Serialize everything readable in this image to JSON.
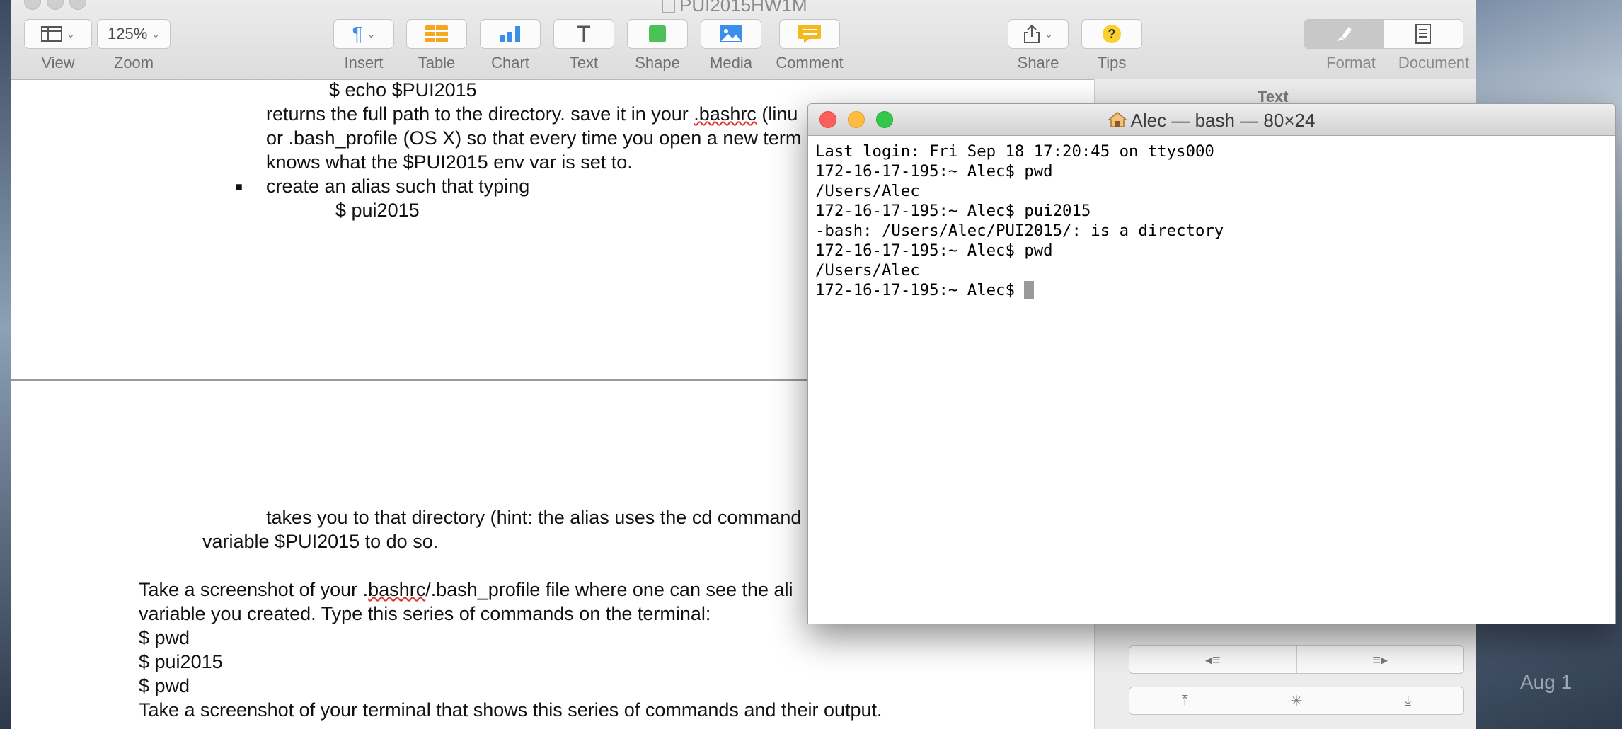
{
  "pages_window": {
    "title": "PUI2015HW1M",
    "toolbar": {
      "view_label": "View",
      "zoom_value": "125%",
      "zoom_label": "Zoom",
      "insert_label": "Insert",
      "table_label": "Table",
      "chart_label": "Chart",
      "text_label": "Text",
      "shape_label": "Shape",
      "media_label": "Media",
      "comment_label": "Comment",
      "share_label": "Share",
      "tips_label": "Tips",
      "format_label": "Format",
      "document_label": "Document"
    },
    "inspector": {
      "heading": "Text"
    },
    "document": {
      "lines": {
        "l1": "$ echo $PUI2015",
        "l2a": "returns the full path to the directory. save  it in your ",
        "l2b": ".bashrc",
        "l2c": " (linu",
        "l3": "or .bash_profile (OS X) so that every time you open a new term",
        "l4": "knows what the $PUI2015 env var is set to.",
        "l5": "create an alias such that typing",
        "l6": "$ pui2015",
        "l7": "takes you to that directory (hint: the alias uses the cd command",
        "l8": "variable $PUI2015 to do so.",
        "l9a": "Take a screenshot of your .",
        "l9b": "bashrc",
        "l9c": "/.bash_profile file where one can see the ali",
        "l10": "variable you created. Type this series of commands on the terminal:",
        "l11": "$ pwd",
        "l12": "$ pui2015",
        "l13": "$ pwd",
        "l14": "Take a screenshot of your terminal that shows this series of commands and their output."
      },
      "bullet_glyph": "■"
    }
  },
  "terminal": {
    "title": "Alec — bash — 80×24",
    "lines": [
      "Last login: Fri Sep 18 17:20:45 on ttys000",
      "172-16-17-195:~ Alec$ pwd",
      "/Users/Alec",
      "172-16-17-195:~ Alec$ pui2015",
      "-bash: /Users/Alec/PUI2015/: is a directory",
      "172-16-17-195:~ Alec$ pwd",
      "/Users/Alec"
    ],
    "prompt": "172-16-17-195:~ Alec$ "
  },
  "desktop": {
    "date_text": "Aug 1"
  },
  "colors": {
    "close": "#fc605b",
    "minimize": "#fdbc40",
    "maximize": "#34c84a",
    "spellcheck": "#e0312c",
    "accent_blue": "#3b8eea"
  },
  "icons": [
    "layout-icon",
    "paragraph-icon",
    "table-icon",
    "chart-icon",
    "text-icon",
    "shape-icon",
    "media-icon",
    "comment-icon",
    "share-icon",
    "tips-icon",
    "format-brush-icon",
    "document-icon",
    "home-icon"
  ]
}
